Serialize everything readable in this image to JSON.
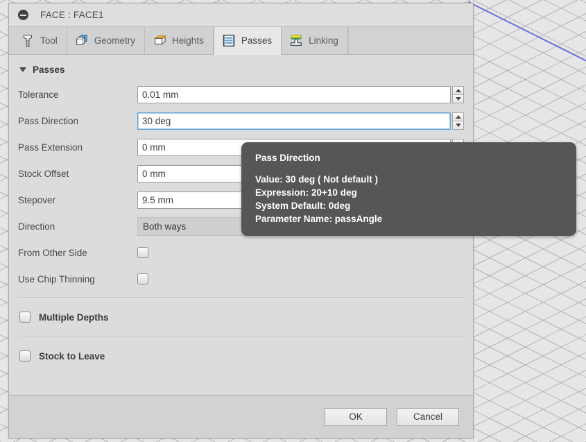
{
  "window": {
    "title": "FACE : FACE1",
    "collapse_icon": "minus-circle-icon"
  },
  "tabs": [
    {
      "label": "Tool",
      "icon": "tool-icon",
      "active": false
    },
    {
      "label": "Geometry",
      "icon": "geometry-icon",
      "active": false
    },
    {
      "label": "Heights",
      "icon": "heights-icon",
      "active": false
    },
    {
      "label": "Passes",
      "icon": "passes-icon",
      "active": true
    },
    {
      "label": "Linking",
      "icon": "linking-icon",
      "active": false
    }
  ],
  "passes_section": {
    "header": "Passes",
    "caret_icon": "caret-down-icon",
    "fields": [
      {
        "label": "Tolerance",
        "value": "0.01 mm",
        "focused": false,
        "spinner": true
      },
      {
        "label": "Pass Direction",
        "value": "30 deg",
        "focused": true,
        "spinner": true
      },
      {
        "label": "Pass Extension",
        "value": "0 mm",
        "focused": false,
        "spinner": true
      },
      {
        "label": "Stock Offset",
        "value": "0 mm",
        "focused": false,
        "spinner": true
      },
      {
        "label": "Stepover",
        "value": "9.5 mm",
        "focused": false,
        "spinner": true
      }
    ],
    "direction": {
      "label": "Direction",
      "value": "Both ways",
      "caret_icon": "chevron-down-icon"
    },
    "checkboxes": [
      {
        "label": "From Other Side",
        "checked": false
      },
      {
        "label": "Use Chip Thinning",
        "checked": false
      }
    ]
  },
  "groups": [
    {
      "label": "Multiple Depths",
      "checked": false
    },
    {
      "label": "Stock to Leave",
      "checked": false
    }
  ],
  "footer": {
    "ok_label": "OK",
    "cancel_label": "Cancel"
  },
  "tooltip": {
    "title": "Pass Direction",
    "lines": [
      "Value: 30 deg ( Not default )",
      "Expression: 20+10 deg",
      "System Default: 0deg",
      "Parameter Name: passAngle"
    ]
  },
  "colors": {
    "panel_bg": "#dcdcdc",
    "tab_active_bg": "#e8e8e8",
    "tooltip_bg": "#565656",
    "focus_border": "#5d9fd4",
    "viewport_edge": "#6f6fe0"
  }
}
